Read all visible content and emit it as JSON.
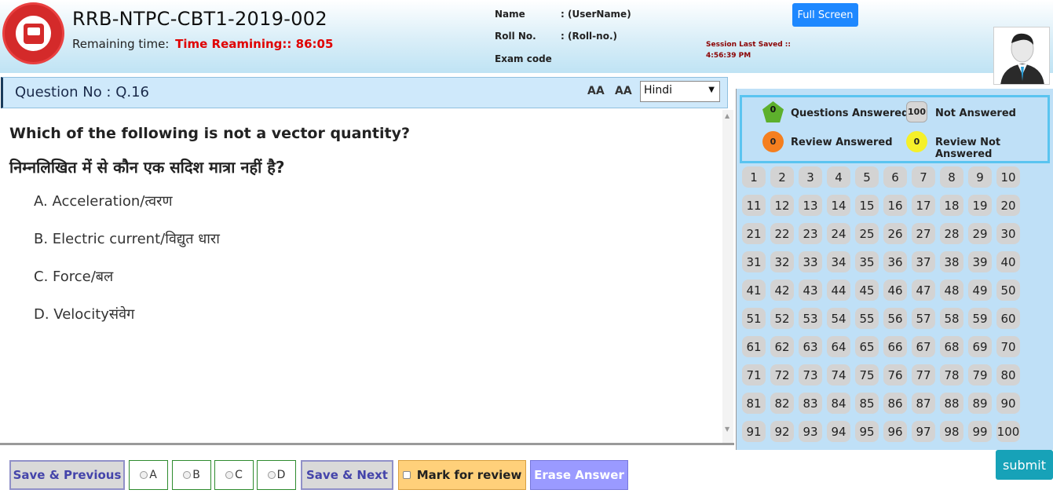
{
  "header": {
    "exam_title": "RRB-NTPC-CBT1-2019-002",
    "remaining_label": "Remaining time:",
    "timer_text": "Time Reamining:: 86:05",
    "name_label": "Name",
    "name_value": ": (UserName)",
    "roll_label": "Roll No.",
    "roll_value": ": (Roll-no.)",
    "exam_code_label": "Exam code",
    "session_label": "Session Last Saved ::",
    "session_time": "4:56:39 PM",
    "fullscreen_label": "Full Screen",
    "logo_icon": "indian-railways-logo",
    "avatar_icon": "user-avatar-icon"
  },
  "question_bar": {
    "question_no": "Question No : Q.16",
    "font_increase": "AA",
    "font_decrease": "AA",
    "language_selected": "Hindi"
  },
  "question": {
    "text_en": "Which of the following is not a vector quantity?",
    "text_hi": "निम्नलिखित में से कौन एक सदिश मात्रा नहीं है?",
    "options": [
      "A. Acceleration/त्वरण",
      "B. Electric current/विद्युत धारा",
      "C. Force/बल",
      "D. Velocityसंवेग"
    ]
  },
  "actions": {
    "save_previous": "Save & Previous",
    "opt_a": "A",
    "opt_b": "B",
    "opt_c": "C",
    "opt_d": "D",
    "save_next": "Save & Next",
    "mark_review": "Mark for review",
    "erase": "Erase Answer",
    "submit": "submit"
  },
  "legend": {
    "answered_count": "0",
    "answered_label": "Questions Answered",
    "not_answered_count": "100",
    "not_answered_label": "Not Answered",
    "review_answered_count": "0",
    "review_answered_label": "Review Answered",
    "review_not_answered_count": "0",
    "review_not_answered_label": "Review Not Answered",
    "colors": {
      "answered": "#5db02c",
      "not_answered": "#d6d6d6",
      "review_answered": "#f57f1f",
      "review_not_answered": "#f5f02a"
    }
  },
  "palette": {
    "question_numbers": [
      "1",
      "2",
      "3",
      "4",
      "5",
      "6",
      "7",
      "8",
      "9",
      "10",
      "11",
      "12",
      "13",
      "14",
      "15",
      "16",
      "17",
      "18",
      "19",
      "20",
      "21",
      "22",
      "23",
      "24",
      "25",
      "26",
      "27",
      "28",
      "29",
      "30",
      "31",
      "32",
      "33",
      "34",
      "35",
      "36",
      "37",
      "38",
      "39",
      "40",
      "41",
      "42",
      "43",
      "44",
      "45",
      "46",
      "47",
      "48",
      "49",
      "50",
      "51",
      "52",
      "53",
      "54",
      "55",
      "56",
      "57",
      "58",
      "59",
      "60",
      "61",
      "62",
      "63",
      "64",
      "65",
      "66",
      "67",
      "68",
      "69",
      "70",
      "71",
      "72",
      "73",
      "74",
      "75",
      "76",
      "77",
      "78",
      "79",
      "80",
      "81",
      "82",
      "83",
      "84",
      "85",
      "86",
      "87",
      "88",
      "89",
      "90",
      "91",
      "92",
      "93",
      "94",
      "95",
      "96",
      "97",
      "98",
      "99",
      "100"
    ]
  }
}
